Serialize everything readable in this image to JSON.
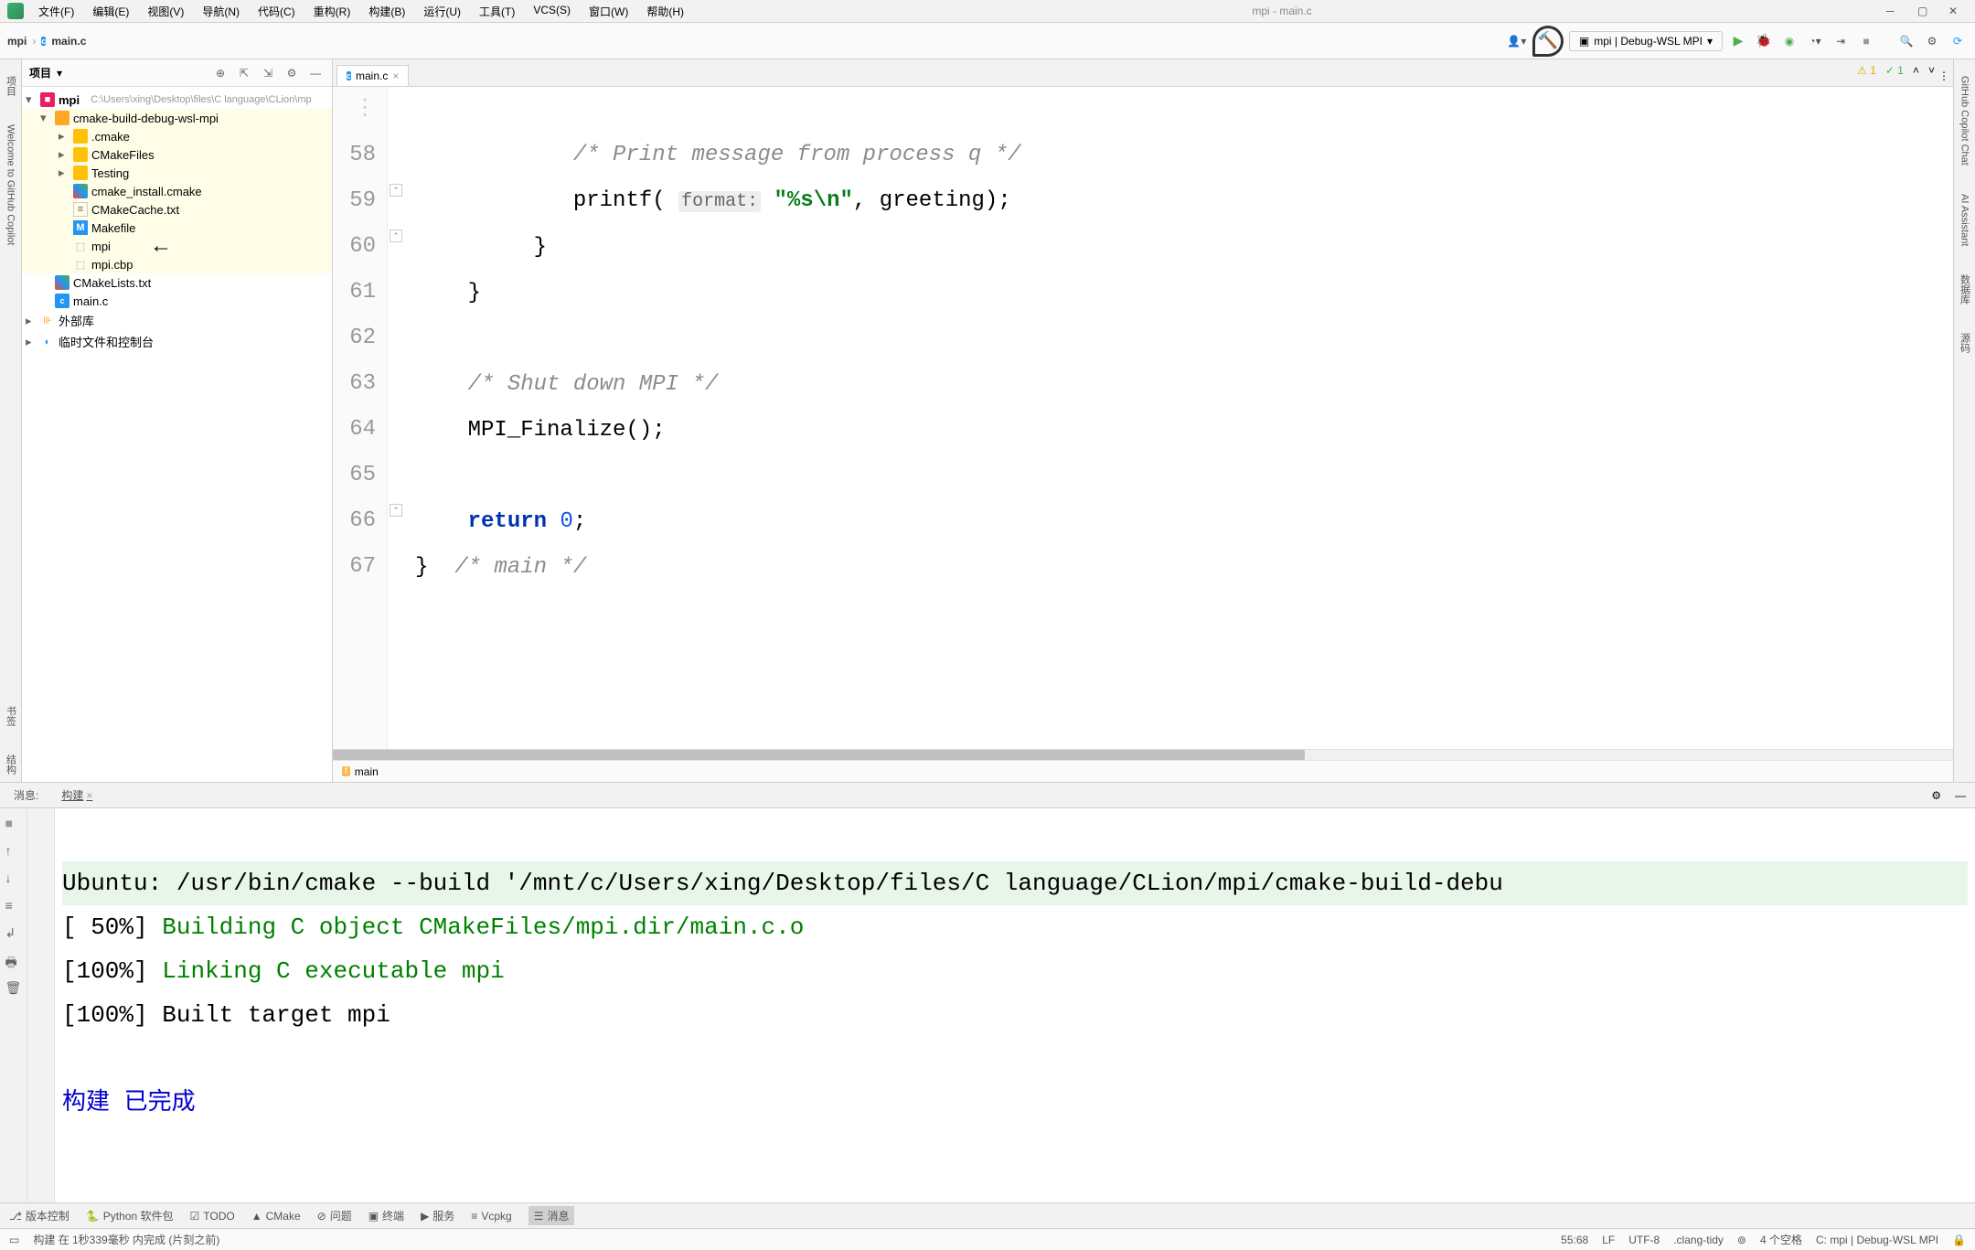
{
  "window": {
    "title": "mpi - main.c"
  },
  "menu": [
    {
      "label": "文件(F)"
    },
    {
      "label": "编辑(E)"
    },
    {
      "label": "视图(V)"
    },
    {
      "label": "导航(N)"
    },
    {
      "label": "代码(C)"
    },
    {
      "label": "重构(R)"
    },
    {
      "label": "构建(B)"
    },
    {
      "label": "运行(U)"
    },
    {
      "label": "工具(T)"
    },
    {
      "label": "VCS(S)"
    },
    {
      "label": "窗口(W)"
    },
    {
      "label": "帮助(H)"
    }
  ],
  "breadcrumb": {
    "root": "mpi",
    "file": "main.c"
  },
  "run_config": {
    "label": "mpi | Debug-WSL MPI"
  },
  "project": {
    "title": "项目",
    "root": {
      "name": "mpi",
      "path": "C:\\Users\\xing\\Desktop\\files\\C language\\CLion\\mp"
    },
    "nodes": {
      "build_dir": "cmake-build-debug-wsl-mpi",
      "cmake_dir": ".cmake",
      "cmakefiles_dir": "CMakeFiles",
      "testing_dir": "Testing",
      "cmake_install": "cmake_install.cmake",
      "cmakecache": "CMakeCache.txt",
      "makefile": "Makefile",
      "mpi_exe": "mpi",
      "mpi_cbp": "mpi.cbp",
      "cmakelists": "CMakeLists.txt",
      "main_c": "main.c",
      "ext_libs": "外部库",
      "temp_console": "临时文件和控制台"
    }
  },
  "editor": {
    "tab": "main.c",
    "lines": [
      "58",
      "59",
      "60",
      "61",
      "62",
      "63",
      "64",
      "65",
      "66",
      "67"
    ],
    "code": {
      "l_top_comment": "/* Print message from process q */",
      "l58_a": "printf(",
      "l58_hint": "format:",
      "l58_str": "\"%s\\n\"",
      "l58_b": ", greeting);",
      "l59": "}",
      "l60": "}",
      "l62_comment": "/* Shut down MPI */",
      "l63": "MPI_Finalize();",
      "l65_return": "return",
      "l65_zero": "0",
      "l65_semi": ";",
      "l66_brace": "}",
      "l66_comment": "/* main */"
    },
    "warnings": "1",
    "typos": "1",
    "breadcrumb_fn": "main"
  },
  "build": {
    "tab_msg": "消息:",
    "tab_build": "构建",
    "output": {
      "line1": "Ubuntu: /usr/bin/cmake --build '/mnt/c/Users/xing/Desktop/files/C language/CLion/mpi/cmake-build-debu",
      "line2_pct": "[ 50%]",
      "line2_msg": "Building C object CMakeFiles/mpi.dir/main.c.o",
      "line3_pct": "[100%]",
      "line3_msg": "Linking C executable mpi",
      "line4": "[100%] Built target mpi",
      "done": "构建 已完成"
    }
  },
  "bottom_tools": {
    "version_control": "版本控制",
    "python_pkg": "Python 软件包",
    "todo": "TODO",
    "cmake": "CMake",
    "problems": "问题",
    "terminal": "终端",
    "services": "服务",
    "vcpkg": "Vcpkg",
    "messages": "消息"
  },
  "status": {
    "build_msg": "构建 在 1秒339毫秒 内完成 (片刻之前)",
    "pos": "55:68",
    "line_sep": "LF",
    "encoding": "UTF-8",
    "analyzer": ".clang-tidy",
    "indent": "4 个空格",
    "context": "C: mpi | Debug-WSL MPI"
  },
  "left_tabs": {
    "copilot": "Welcome to GitHub Copilot"
  },
  "right_tabs": {
    "copilot_chat": "GitHub Copilot Chat",
    "ai": "AI Assistant",
    "db": "数据库",
    "src": "源码"
  }
}
